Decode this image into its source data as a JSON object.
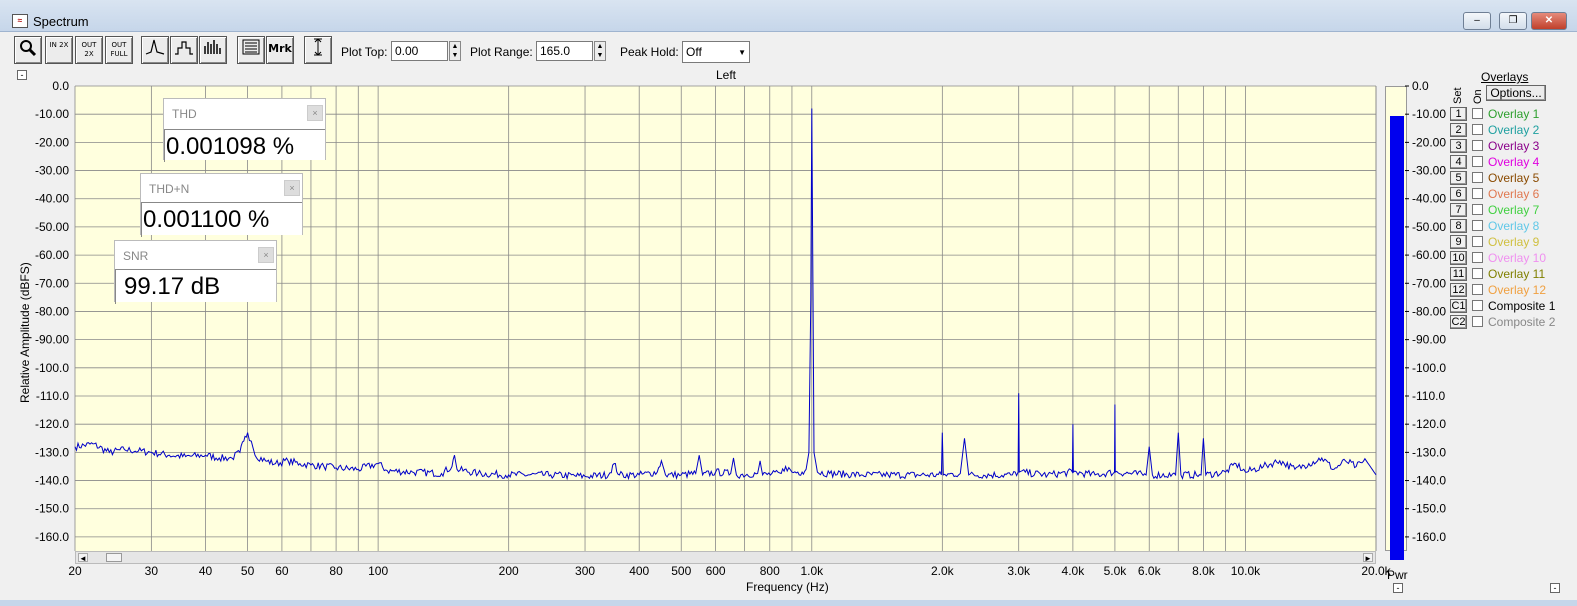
{
  "window": {
    "title": "Spectrum",
    "icon": "spectrum-app-icon"
  },
  "toolbar": {
    "buttons": [
      {
        "name": "zoom-button",
        "text": "",
        "icon": "magnifier-icon"
      },
      {
        "name": "zoom-in-2x-button",
        "text": "IN 2X"
      },
      {
        "name": "zoom-out-2x-button",
        "text": "OUT 2X"
      },
      {
        "name": "zoom-out-full-button",
        "text": "OUT FULL"
      },
      {
        "name": "line-mode-button",
        "text": "",
        "icon": "line-trace-icon"
      },
      {
        "name": "step-mode-button",
        "text": "",
        "icon": "step-trace-icon"
      },
      {
        "name": "bar-mode-button",
        "text": "",
        "icon": "bar-trace-icon"
      },
      {
        "name": "data-window-button",
        "text": "",
        "icon": "data-window-icon"
      },
      {
        "name": "markers-button",
        "text": "Mrk"
      },
      {
        "name": "cursor-button",
        "text": "",
        "icon": "cursor-icon"
      }
    ],
    "plot_top_label": "Plot Top:",
    "plot_top_value": "0.00",
    "plot_range_label": "Plot Range:",
    "plot_range_value": "165.0",
    "peak_hold_label": "Peak Hold:",
    "peak_hold_value": "Off"
  },
  "plot": {
    "title": "Left",
    "collapse_symbol": "-",
    "xlabel": "Frequency (Hz)",
    "ylabel": "Relative Amplitude (dBFS)",
    "y_ticks": [
      "0.0",
      "-10.00",
      "-20.00",
      "-30.00",
      "-40.00",
      "-50.00",
      "-60.00",
      "-70.00",
      "-80.00",
      "-90.00",
      "-100.0",
      "-110.0",
      "-120.0",
      "-130.0",
      "-140.0",
      "-150.0",
      "-160.0"
    ],
    "x_ticks": [
      {
        "f": 20,
        "label": "20"
      },
      {
        "f": 30,
        "label": "30"
      },
      {
        "f": 40,
        "label": "40"
      },
      {
        "f": 50,
        "label": "50"
      },
      {
        "f": 60,
        "label": "60"
      },
      {
        "f": 80,
        "label": "80"
      },
      {
        "f": 100,
        "label": "100"
      },
      {
        "f": 200,
        "label": "200"
      },
      {
        "f": 300,
        "label": "300"
      },
      {
        "f": 400,
        "label": "400"
      },
      {
        "f": 500,
        "label": "500"
      },
      {
        "f": 600,
        "label": "600"
      },
      {
        "f": 800,
        "label": "800"
      },
      {
        "f": 1000,
        "label": "1.0k"
      },
      {
        "f": 2000,
        "label": "2.0k"
      },
      {
        "f": 3000,
        "label": "3.0k"
      },
      {
        "f": 4000,
        "label": "4.0k"
      },
      {
        "f": 5000,
        "label": "5.0k"
      },
      {
        "f": 6000,
        "label": "6.0k"
      },
      {
        "f": 8000,
        "label": "8.0k"
      },
      {
        "f": 10000,
        "label": "10.0k"
      },
      {
        "f": 20000,
        "label": "20.0k"
      }
    ]
  },
  "meters": [
    {
      "name": "thd-meter",
      "label": "THD",
      "value": "0.001098 %"
    },
    {
      "name": "thdn-meter",
      "label": "THD+N",
      "value": "0.001100 %"
    },
    {
      "name": "snr-meter",
      "label": "SNR",
      "value": "99.17 dB"
    }
  ],
  "pwr_meter": {
    "label": "Pwr",
    "level_dbfs": -7.5,
    "ticks": [
      "0.0",
      "-10.00",
      "-20.00",
      "-30.00",
      "-40.00",
      "-50.00",
      "-60.00",
      "-70.00",
      "-80.00",
      "-90.00",
      "-100.0",
      "-110.0",
      "-120.0",
      "-130.0",
      "-140.0",
      "-150.0",
      "-160.0"
    ]
  },
  "overlays": {
    "header": "Overlays",
    "options_label": "Options...",
    "set_header": "Set",
    "on_header": "On",
    "items": [
      {
        "num": "1",
        "label": "Overlay 1",
        "color": "#2ea02e"
      },
      {
        "num": "2",
        "label": "Overlay 2",
        "color": "#1fa0a0"
      },
      {
        "num": "3",
        "label": "Overlay 3",
        "color": "#8a008a"
      },
      {
        "num": "4",
        "label": "Overlay 4",
        "color": "#e000e0"
      },
      {
        "num": "5",
        "label": "Overlay 5",
        "color": "#8a4a00"
      },
      {
        "num": "6",
        "label": "Overlay 6",
        "color": "#e07850"
      },
      {
        "num": "7",
        "label": "Overlay 7",
        "color": "#40d040"
      },
      {
        "num": "8",
        "label": "Overlay 8",
        "color": "#60c8e8"
      },
      {
        "num": "9",
        "label": "Overlay 9",
        "color": "#d0c040"
      },
      {
        "num": "10",
        "label": "Overlay 10",
        "color": "#f090f0"
      },
      {
        "num": "11",
        "label": "Overlay 11",
        "color": "#808000"
      },
      {
        "num": "12",
        "label": "Overlay 12",
        "color": "#f0a040"
      },
      {
        "num": "C1",
        "label": "Composite 1",
        "color": "#000000"
      },
      {
        "num": "C2",
        "label": "Composite 2",
        "color": "#888888"
      }
    ]
  },
  "chart_data": {
    "type": "line",
    "xlabel": "Frequency (Hz)",
    "ylabel": "Relative Amplitude (dBFS)",
    "title": "Left",
    "x_scale": "log",
    "xlim": [
      20,
      20000
    ],
    "ylim": [
      -165,
      0
    ],
    "grid": true,
    "series": [
      {
        "color": "#0000c8",
        "points": [
          [
            20,
            -128
          ],
          [
            22,
            -127
          ],
          [
            24,
            -130
          ],
          [
            26,
            -129
          ],
          [
            28,
            -129.5
          ],
          [
            30,
            -130
          ],
          [
            33,
            -131
          ],
          [
            36,
            -131.5
          ],
          [
            40,
            -131
          ],
          [
            43,
            -132
          ],
          [
            46,
            -132
          ],
          [
            48,
            -130
          ],
          [
            49,
            -126
          ],
          [
            50,
            -123
          ],
          [
            51,
            -126
          ],
          [
            52,
            -131
          ],
          [
            55,
            -133
          ],
          [
            58,
            -134
          ],
          [
            62,
            -133
          ],
          [
            66,
            -134
          ],
          [
            70,
            -134.5
          ],
          [
            75,
            -135
          ],
          [
            80,
            -135.5
          ],
          [
            90,
            -136
          ],
          [
            100,
            -134
          ],
          [
            105,
            -136.5
          ],
          [
            120,
            -137
          ],
          [
            140,
            -137.5
          ],
          [
            148,
            -135
          ],
          [
            150,
            -131
          ],
          [
            152,
            -136
          ],
          [
            170,
            -137.5
          ],
          [
            200,
            -138
          ],
          [
            250,
            -138
          ],
          [
            300,
            -138.5
          ],
          [
            340,
            -138
          ],
          [
            350,
            -134
          ],
          [
            360,
            -138
          ],
          [
            400,
            -138
          ],
          [
            440,
            -137
          ],
          [
            450,
            -133
          ],
          [
            460,
            -138
          ],
          [
            500,
            -138
          ],
          [
            540,
            -137.5
          ],
          [
            550,
            -131
          ],
          [
            560,
            -138
          ],
          [
            600,
            -137
          ],
          [
            650,
            -137.5
          ],
          [
            660,
            -132
          ],
          [
            670,
            -138
          ],
          [
            750,
            -137.5
          ],
          [
            760,
            -133
          ],
          [
            770,
            -138
          ],
          [
            850,
            -137.5
          ],
          [
            870,
            -135
          ],
          [
            900,
            -137
          ],
          [
            950,
            -137
          ],
          [
            970,
            -136
          ],
          [
            985,
            -130
          ],
          [
            995,
            -76
          ],
          [
            1000,
            -8
          ],
          [
            1005,
            -58
          ],
          [
            1012,
            -130
          ],
          [
            1030,
            -137
          ],
          [
            1100,
            -137.5
          ],
          [
            1300,
            -138
          ],
          [
            1500,
            -138
          ],
          [
            1990,
            -138
          ],
          [
            2000,
            -123
          ],
          [
            2010,
            -138
          ],
          [
            2200,
            -137.5
          ],
          [
            2250,
            -125
          ],
          [
            2300,
            -138
          ],
          [
            2900,
            -138
          ],
          [
            2990,
            -137
          ],
          [
            3000,
            -109
          ],
          [
            3010,
            -137
          ],
          [
            3500,
            -138
          ],
          [
            3990,
            -137
          ],
          [
            4000,
            -120
          ],
          [
            4010,
            -137
          ],
          [
            4500,
            -138
          ],
          [
            4990,
            -137
          ],
          [
            5000,
            -113
          ],
          [
            5010,
            -137
          ],
          [
            5900,
            -138
          ],
          [
            6000,
            -128
          ],
          [
            6100,
            -138
          ],
          [
            6900,
            -138
          ],
          [
            7000,
            -123
          ],
          [
            7100,
            -138
          ],
          [
            7900,
            -138
          ],
          [
            8000,
            -125
          ],
          [
            8100,
            -138
          ],
          [
            9000,
            -137
          ],
          [
            9500,
            -134
          ],
          [
            10000,
            -137
          ],
          [
            11000,
            -135
          ],
          [
            12000,
            -133
          ],
          [
            13000,
            -136
          ],
          [
            14000,
            -134
          ],
          [
            15000,
            -132
          ],
          [
            16000,
            -136
          ],
          [
            17000,
            -133
          ],
          [
            18000,
            -135
          ],
          [
            19000,
            -133
          ],
          [
            20000,
            -138
          ]
        ]
      }
    ],
    "peaks": [
      {
        "f": 50,
        "db": -123
      },
      {
        "f": 1000,
        "db": -8
      },
      {
        "f": 2000,
        "db": -123
      },
      {
        "f": 3000,
        "db": -109
      },
      {
        "f": 4000,
        "db": -120
      },
      {
        "f": 5000,
        "db": -113
      }
    ]
  }
}
